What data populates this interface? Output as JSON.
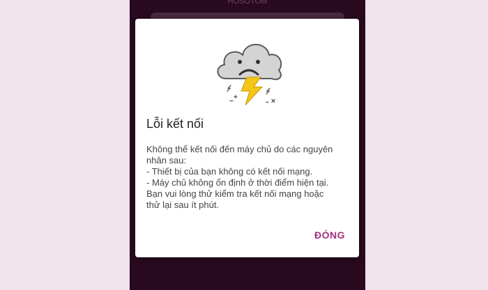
{
  "app": {
    "top_text": "HOSOTOM"
  },
  "dialog": {
    "title": "Lỗi kết nối",
    "message_lines": [
      "Không thể kết nối đến máy chủ do các nguyên",
      "nhân sau:",
      " - Thiết bị của bạn không có kết nối mạng.",
      " - Máy chủ không ổn định ở thời điểm hiện tại.",
      "Bạn vui lòng thử kiểm tra kết nối mạng hoặc",
      "thử lại sau ít phút."
    ],
    "close_label": "ĐÓNG",
    "icon": "sad-cloud-lightning-icon"
  },
  "colors": {
    "backdrop": "#efe3ec",
    "phone_background": "#2a0a1f",
    "accent": "#a2327e",
    "lightning": "#f5c518"
  }
}
